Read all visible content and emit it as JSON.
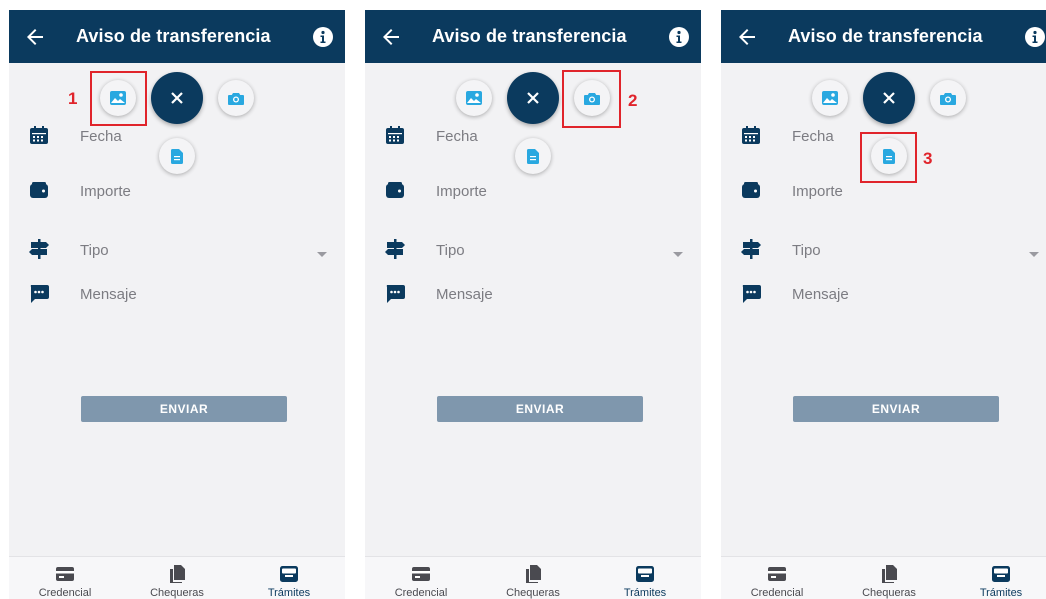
{
  "screens": [
    {
      "title": "Aviso de transferencia",
      "fields": {
        "fecha": "Fecha",
        "importe": "Importe",
        "tipo": "Tipo",
        "mensaje": "Mensaje"
      },
      "send_label": "ENVIAR",
      "highlight_number": "1",
      "highlight_target": "gallery",
      "nav": [
        "Credencial",
        "Chequeras",
        "Trámites"
      ]
    },
    {
      "title": "Aviso de transferencia",
      "fields": {
        "fecha": "Fecha",
        "importe": "Importe",
        "tipo": "Tipo",
        "mensaje": "Mensaje"
      },
      "send_label": "ENVIAR",
      "highlight_number": "2",
      "highlight_target": "camera",
      "nav": [
        "Credencial",
        "Chequeras",
        "Trámites"
      ]
    },
    {
      "title": "Aviso de transferencia",
      "fields": {
        "fecha": "Fecha",
        "importe": "Importe",
        "tipo": "Tipo",
        "mensaje": "Mensaje"
      },
      "send_label": "ENVIAR",
      "highlight_number": "3",
      "highlight_target": "document",
      "nav": [
        "Credencial",
        "Chequeras",
        "Trámites"
      ]
    }
  ],
  "icons": {
    "back": "arrow-back-icon",
    "info": "info-icon",
    "fecha": "calendar-icon",
    "importe": "wallet-icon",
    "tipo": "signpost-icon",
    "mensaje": "message-icon",
    "gallery": "image-icon",
    "camera": "camera-icon",
    "document": "document-icon",
    "close": "close-icon",
    "nav": [
      "id-card-icon",
      "copy-docs-icon",
      "inbox-icon"
    ]
  },
  "colors": {
    "primary": "#0b3a5e",
    "accent": "#29a8e0",
    "button": "#7f97ad",
    "highlight": "#e0242b",
    "background": "#f2f2f4"
  },
  "active_nav_index": 2
}
